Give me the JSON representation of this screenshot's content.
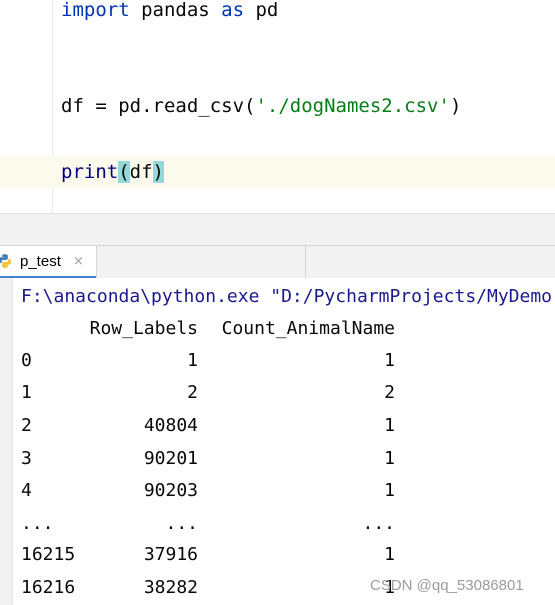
{
  "editor": {
    "line1": {
      "kw1": "import",
      "plain1": " pandas ",
      "kw2": "as",
      "plain2": " pd"
    },
    "line2": {
      "plain1": "df = pd.read_csv(",
      "str": "'./dogNames2.csv'",
      "plain2": ")"
    },
    "line3": {
      "fn": "print",
      "open": "(",
      "arg": "df",
      "close": ")"
    }
  },
  "run_window": {
    "tab_label": "p_test",
    "tab_close": "×",
    "command_line": "F:\\anaconda\\python.exe \"D:/PycharmProjects/MyDemo"
  },
  "table": {
    "columns": [
      "Row_Labels",
      "Count_AnimalName"
    ],
    "rows": [
      {
        "index": "0",
        "row_labels": "1",
        "count": "1"
      },
      {
        "index": "1",
        "row_labels": "2",
        "count": "2"
      },
      {
        "index": "2",
        "row_labels": "40804",
        "count": "1"
      },
      {
        "index": "3",
        "row_labels": "90201",
        "count": "1"
      },
      {
        "index": "4",
        "row_labels": "90203",
        "count": "1"
      },
      {
        "index": "...",
        "row_labels": "...",
        "count": "..."
      },
      {
        "index": "16215",
        "row_labels": "37916",
        "count": "1"
      },
      {
        "index": "16216",
        "row_labels": "38282",
        "count": "1"
      }
    ]
  },
  "watermark": "CSDN @qq_53086801",
  "icons": {
    "tab_icon": "python-icon",
    "close": "close-icon"
  },
  "colors": {
    "keyword": "#0033b3",
    "string": "#067d17",
    "paren_highlight": "#93d9d9",
    "caret_row": "#fcfaed",
    "tab_underline": "#4083c9"
  }
}
